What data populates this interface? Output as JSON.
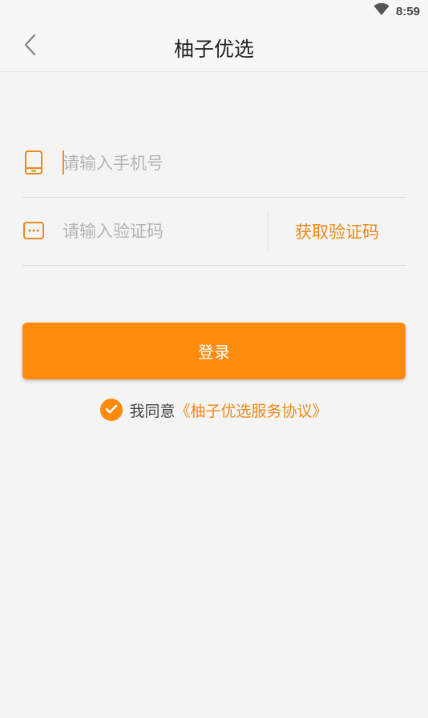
{
  "status_bar": {
    "time": "8:59",
    "icons": [
      "wifi-icon"
    ]
  },
  "header": {
    "title": "柚子优选",
    "back_icon": "chevron-left-icon"
  },
  "form": {
    "phone": {
      "icon": "phone-icon",
      "placeholder": "请输入手机号",
      "value": ""
    },
    "code": {
      "icon": "message-icon",
      "placeholder": "请输入验证码",
      "value": "",
      "get_code_label": "获取验证码"
    }
  },
  "login_button": {
    "label": "登录"
  },
  "agreement": {
    "checked": true,
    "text": "我同意",
    "link": "《柚子优选服务协议》"
  },
  "colors": {
    "accent": "#ff8a0d",
    "accent_text": "#ee8a17",
    "background": "#f4f4f4"
  }
}
